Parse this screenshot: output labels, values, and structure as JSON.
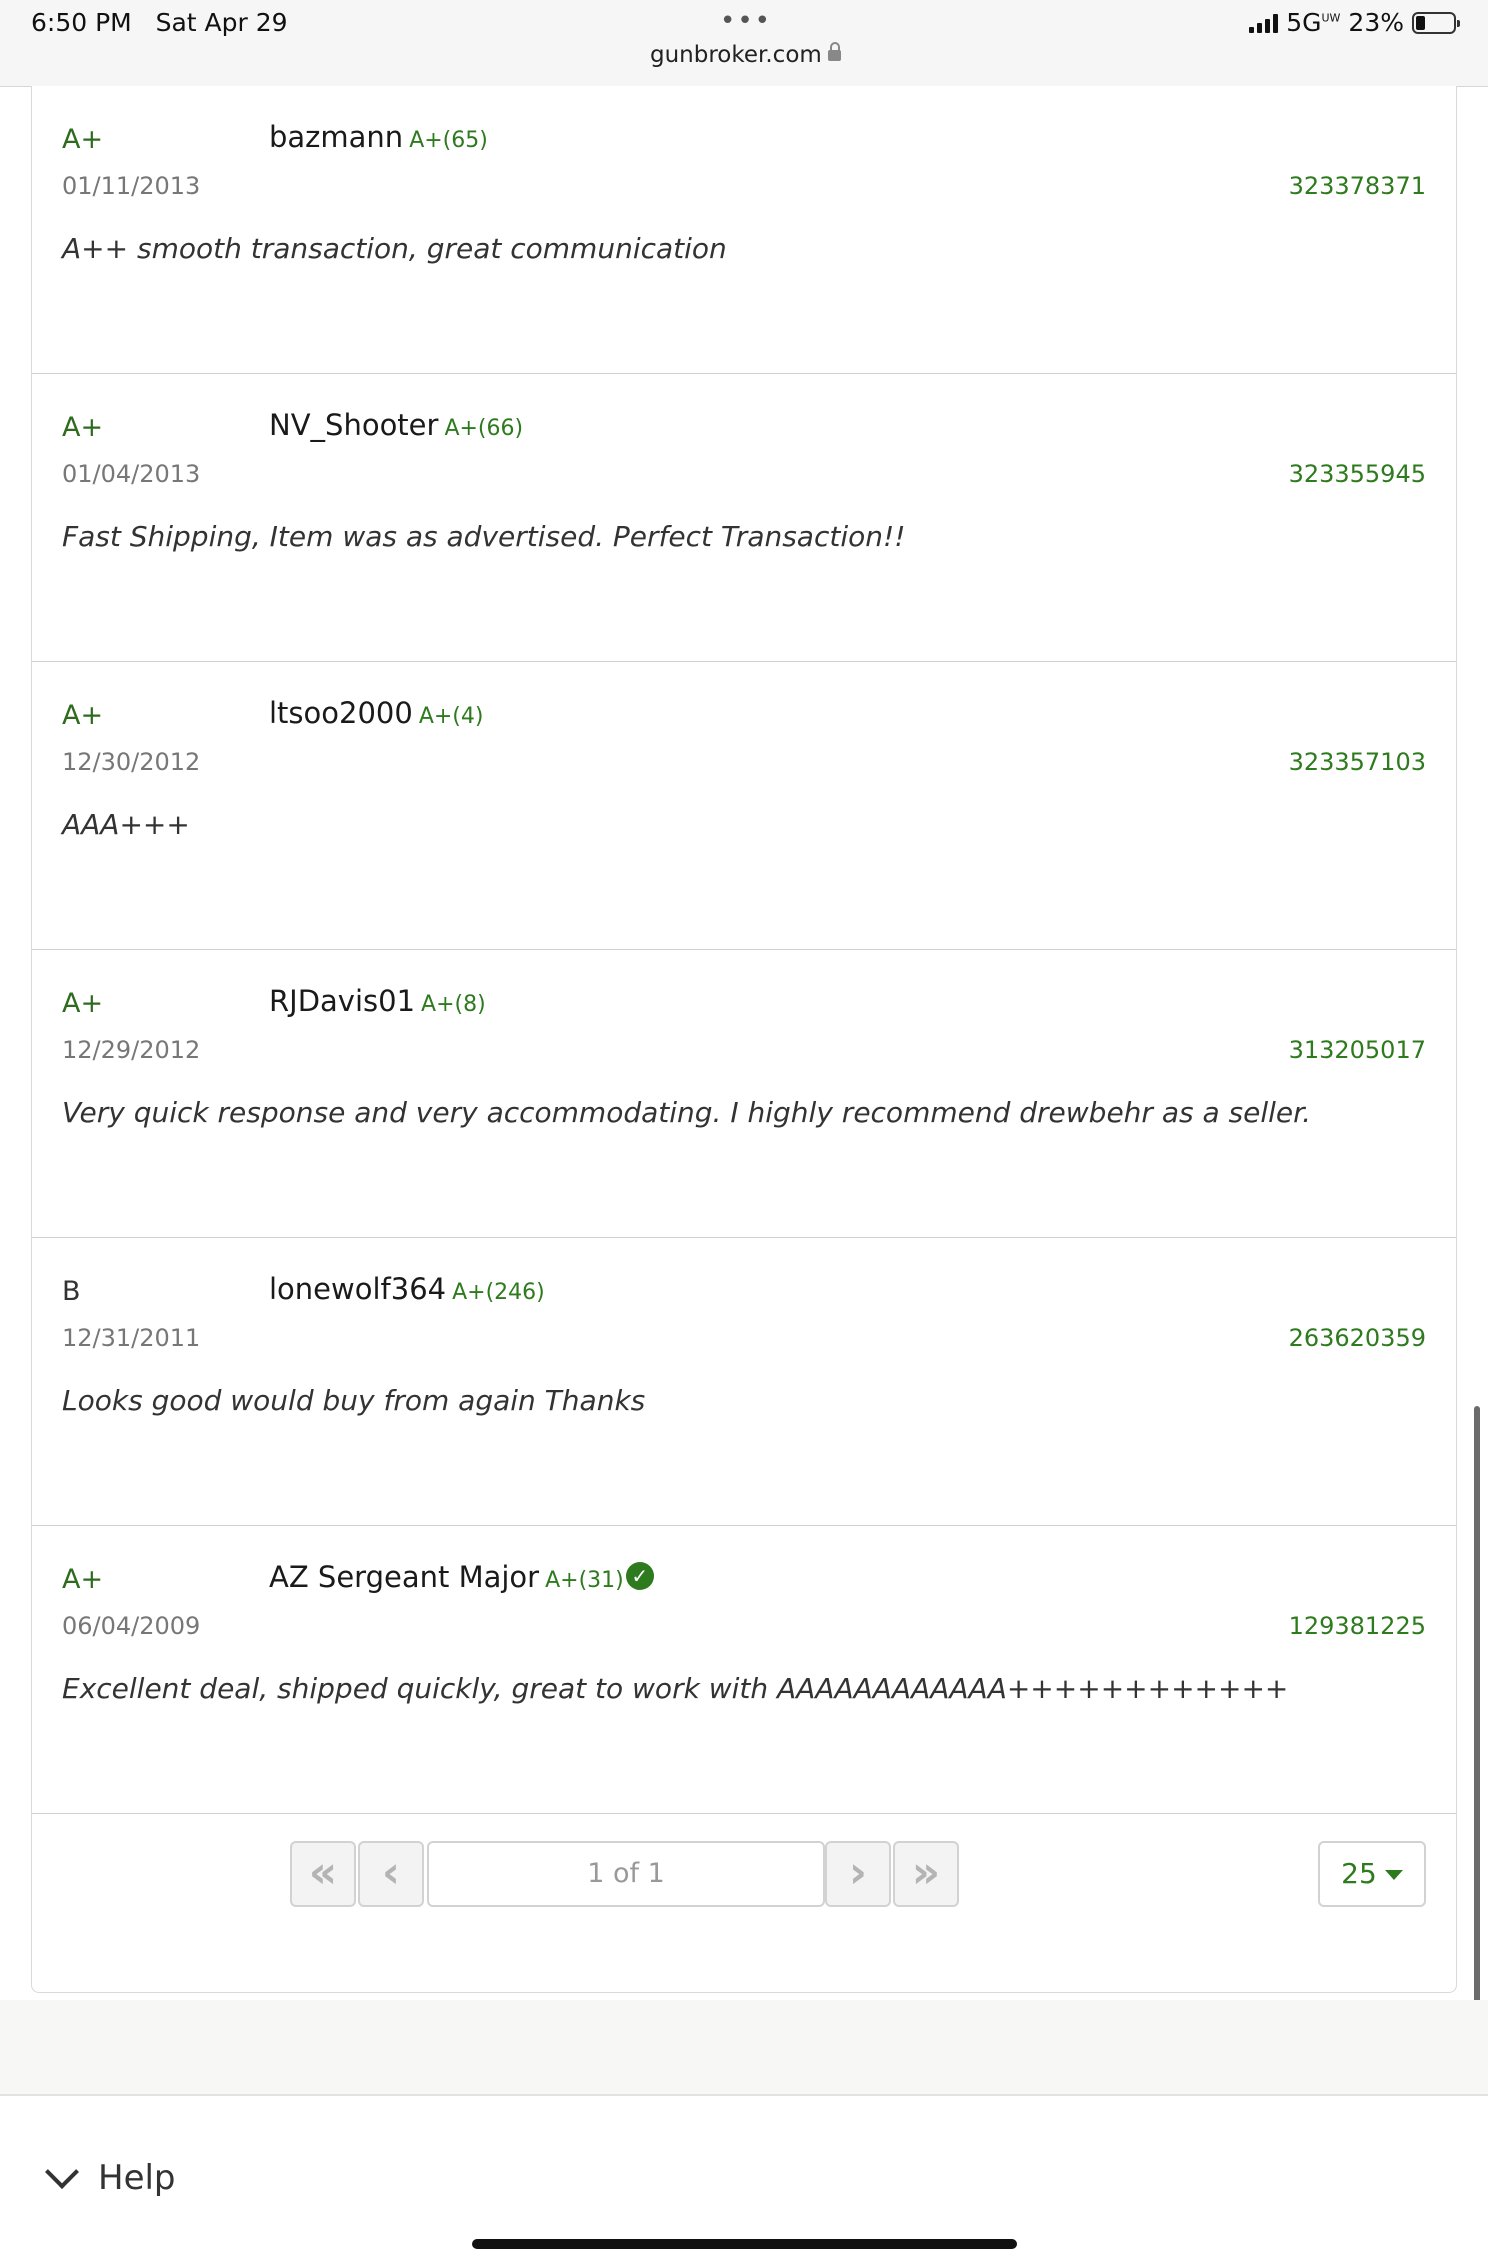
{
  "status_bar": {
    "time": "6:50 PM",
    "date": "Sat Apr 29",
    "url": "gunbroker.com",
    "network": "5G",
    "network_sub": "UW",
    "battery": "23%"
  },
  "feedback": [
    {
      "rating": "A+",
      "user": "bazmann",
      "score": "A+(65)",
      "date": "01/11/2013",
      "item_id": "323378371",
      "comment": "A++ smooth transaction, great communication",
      "verified": false
    },
    {
      "rating": "A+",
      "user": "NV_Shooter",
      "score": "A+(66)",
      "date": "01/04/2013",
      "item_id": "323355945",
      "comment": "Fast Shipping, Item was as advertised. Perfect Transaction!!",
      "verified": false
    },
    {
      "rating": "A+",
      "user": "ltsoo2000",
      "score": "A+(4)",
      "date": "12/30/2012",
      "item_id": "323357103",
      "comment": "AAA+++",
      "verified": false
    },
    {
      "rating": "A+",
      "user": "RJDavis01",
      "score": "A+(8)",
      "date": "12/29/2012",
      "item_id": "313205017",
      "comment": "Very quick response and very accommodating. I highly recommend drewbehr as a seller.",
      "verified": false
    },
    {
      "rating": "B",
      "user": "lonewolf364",
      "score": "A+(246)",
      "date": "12/31/2011",
      "item_id": "263620359",
      "comment": "Looks good would buy from again Thanks",
      "verified": false
    },
    {
      "rating": "A+",
      "user": "AZ Sergeant Major",
      "score": "A+(31)",
      "date": "06/04/2009",
      "item_id": "129381225",
      "comment": "Excellent deal, shipped quickly, great to work with AAAAAAAAAAAA++++++++++++",
      "verified": true
    }
  ],
  "pager": {
    "page_text": "1 of 1",
    "per_page": "25",
    "first_icon": "double-chevron-left-icon",
    "prev_icon": "chevron-left-icon",
    "next_icon": "chevron-right-icon",
    "last_icon": "double-chevron-right-icon"
  },
  "footer": {
    "help_label": "Help",
    "help_icon": "chevron-down-icon"
  },
  "colors": {
    "accent_green": "#2e7a1e",
    "grade_green": "#2e6b1e"
  }
}
